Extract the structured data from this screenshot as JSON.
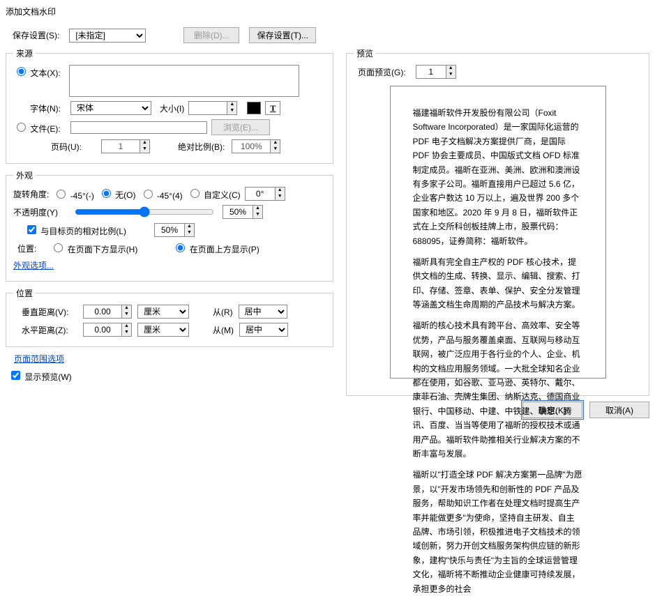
{
  "title": "添加文档水印",
  "saveSettings": {
    "label": "保存设置(S):",
    "selected": "[未指定]",
    "deleteBtn": "删除(D)...",
    "saveBtn": "保存设置(T)..."
  },
  "source": {
    "legend": "来源",
    "textRadio": "文本(X):",
    "textValue": "",
    "fontLabel": "字体(N):",
    "fontSelected": "宋体",
    "sizeLabel": "大小(I)",
    "sizeValue": "",
    "fileRadio": "文件(E):",
    "fileValue": "",
    "browseBtn": "浏览(E)...",
    "pageLabel": "页码(U):",
    "pageValue": "1",
    "absScaleLabel": "绝对比例(B):",
    "absScaleValue": "100%"
  },
  "appearance": {
    "legend": "外观",
    "rotationLabel": "旋转角度:",
    "rotOptNeg45": "-45°(-)",
    "rotOptNone": "无(O)",
    "rotOptPos45": "-45°(4)",
    "rotOptCustom": "自定义(C)",
    "rotValue": "0°",
    "opacityLabel": "不透明度(Y)",
    "opacityValue": "50%",
    "relScaleCheck": "与目标页的相对比例(L)",
    "relScaleValue": "50%",
    "positionLabel": "位置:",
    "posOptBelow": "在页面下方显示(H)",
    "posOptAbove": "在页面上方显示(P)",
    "appearanceOptions": "外观选项..."
  },
  "position": {
    "legend": "位置",
    "vertLabel": "垂直距离(V):",
    "vertValue": "0.00",
    "vertUnit": "厘米",
    "vertFromLabel": "从(R)",
    "vertFrom": "居中",
    "horizLabel": "水平距离(Z):",
    "horizValue": "0.00",
    "horizUnit": "厘米",
    "horizFromLabel": "从(M)",
    "horizFrom": "居中"
  },
  "preview": {
    "legend": "预览",
    "pagePreviewLabel": "页面预览(G):",
    "pagePreviewValue": "1",
    "paragraphs": [
      "福建福昕软件开发股份有限公司（Foxit Software Incorporated）是一家国际化运营的 PDF 电子文档解决方案提供厂商，是国际 PDF 协会主要成员、中国版式文档 OFD 标准制定成员。福昕在亚洲、美洲、欧洲和澳洲设有多家子公司。福昕直接用户已超过 5.6 亿，企业客户数达 10 万以上，遍及世界 200 多个国家和地区。2020 年 9 月 8 日，福昕软件正式在上交所科创板挂牌上市，股票代码：688095，证券简称：福昕软件。",
      "福昕具有完全自主产权的 PDF 核心技术，提供文档的生成、转换、显示、编辑、搜索、打印、存储、签章、表单、保护、安全分发管理等涵盖文档生命周期的产品技术与解决方案。",
      "福昕的核心技术具有跨平台、高效率、安全等优势，产品与服务覆盖桌面、互联网与移动互联网，被广泛应用于各行业的个人、企业、机构的文档应用服务领域。一大批全球知名企业都在使用，如谷歌、亚马逊、英特尔、戴尔、康菲石油、壳牌生集团、纳斯达克、德国商业银行、中国移动、中建、中铁建、联想、腾讯、百度、当当等使用了福昕的授权技术或通用产品。福昕软件助推相关行业解决方案的不断丰富与发展。",
      "福昕以\"打造全球 PDF 解决方案第一品牌\"为愿景，以\"开发市场领先和创新性的 PDF 产品及服务，帮助知识工作者在处理文档时提高生产率并能做更多\"为使命，坚持自主研发、自主品牌、市场引领，积极推进电子文档技术的领域创新，努力开创文档服务架构供应链的新形象，建构\"快乐与责任\"为主旨的全球运营管理文化，福昕将不断推动企业健康可持续发展，承担更多的社会"
    ]
  },
  "pageRangeOptions": "页面范围选项",
  "showPreview": "显示预览(W)",
  "okBtn": "确定(K)",
  "cancelBtn": "取消(A)"
}
